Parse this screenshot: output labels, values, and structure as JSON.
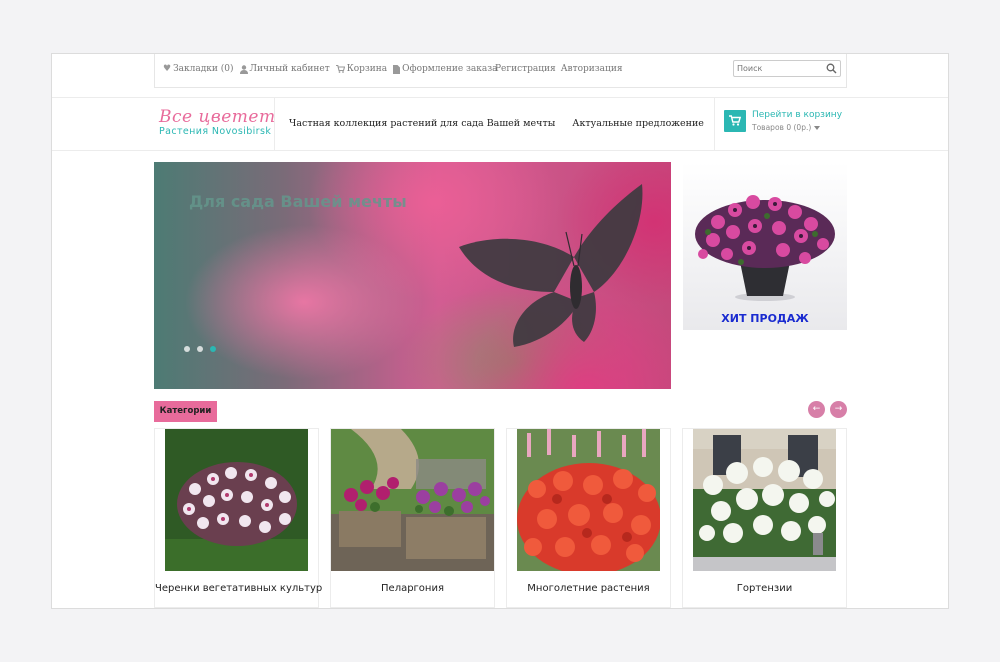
{
  "topbar": {
    "links": [
      {
        "icon": "heart-icon",
        "label": "Закладки (0)"
      },
      {
        "icon": "user-icon",
        "label": "Личный кабинет"
      },
      {
        "icon": "cart-icon",
        "label": "Корзина"
      },
      {
        "icon": "document-icon",
        "label": "Оформление заказа"
      }
    ],
    "register": "Регистрация",
    "login": "Авторизация",
    "search_placeholder": "Поиск"
  },
  "header": {
    "logo_title": "Все цветет",
    "logo_subtitle": "Растения Novosibirsk",
    "nav": [
      "Частная коллекция растений для сада Вашей мечты",
      "Актуальные предложение"
    ],
    "cart_link": "Перейти в корзину",
    "cart_count": "Товаров 0 (0р.)"
  },
  "slider": {
    "title": "Для сада Вашей мечты",
    "dots": 3,
    "active_dot": 3
  },
  "promo": {
    "label": "ХИТ ПРОДАЖ"
  },
  "categories": {
    "tag": "Категории",
    "prev": "←",
    "next": "→",
    "items": [
      {
        "name": "Черенки вегетативных культур"
      },
      {
        "name": "Пеларгония"
      },
      {
        "name": "Многолетние растения"
      },
      {
        "name": "Гортензии"
      }
    ]
  },
  "colors": {
    "accent_teal": "#2bb7b3",
    "accent_pink": "#e86b9b",
    "promo_blue": "#1a2bd0"
  }
}
